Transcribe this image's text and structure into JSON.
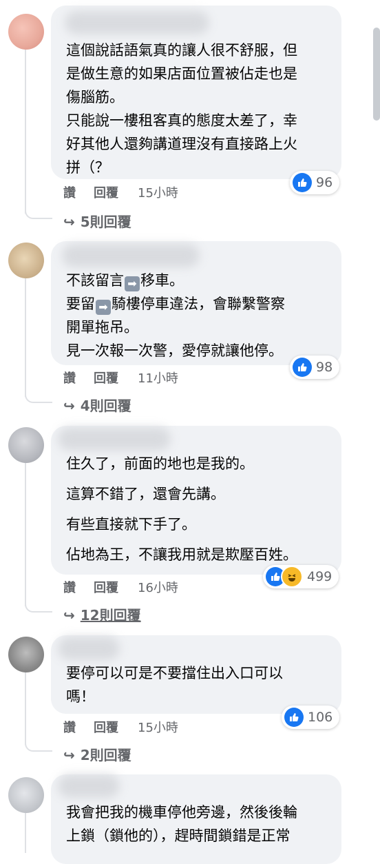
{
  "comments": [
    {
      "lines": [
        "這個說話語氣真的讓人很不舒服，但",
        "是做生意的如果店面位置被佔走也是",
        "傷腦筋。",
        "只能說一樓租客真的態度太差了，幸",
        "好其他人還夠講道理沒有直接路上火",
        "拼（？"
      ],
      "like": "讚",
      "reply": "回覆",
      "time": "15小時",
      "reaction_count": "96",
      "replies_label": "5則回覆"
    },
    {
      "lines": [
        "不該留言",
        "移車。",
        "要留",
        "騎樓停車違法，會聯繫警察",
        "開單拖吊。",
        "見一次報一次警，愛停就讓他停。"
      ],
      "arrow_glyph": "➡",
      "like": "讚",
      "reply": "回覆",
      "time": "11小時",
      "reaction_count": "98",
      "replies_label": "4則回覆"
    },
    {
      "lines": [
        "住久了，前面的地也是我的。",
        "這算不錯了，還會先講。",
        "有些直接就下手了。",
        "佔地為王，不讓我用就是欺壓百姓。"
      ],
      "like": "讚",
      "reply": "回覆",
      "time": "16小時",
      "reaction_count": "499",
      "replies_label": "12則回覆"
    },
    {
      "lines": [
        "要停可以可是不要擋住出入口可以",
        "嗎！"
      ],
      "like": "讚",
      "reply": "回覆",
      "time": "15小時",
      "reaction_count": "106",
      "replies_label": "2則回覆"
    },
    {
      "lines": [
        "我會把我的機車停他旁邊，然後後輪",
        "上鎖（鎖他的），趕時間鎖錯是正常"
      ]
    }
  ],
  "icons": {
    "reply_arrow": "↪",
    "like": "like-thumb-icon",
    "haha": "haha-emoji-icon"
  },
  "colors": {
    "bubble": "#f0f2f5",
    "like_blue": "#1877f2",
    "meta_gray": "#65676b"
  }
}
